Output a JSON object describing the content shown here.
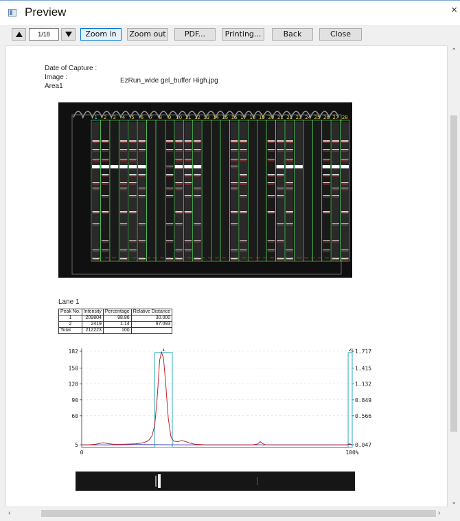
{
  "window": {
    "title": "Preview",
    "close_glyph": "×"
  },
  "toolbar": {
    "page_indicator": "1/18",
    "zoom_in_label": "Zoom in",
    "zoom_out_label": "Zoom out",
    "pdf_label": "PDF...",
    "printing_label": "Printing...",
    "back_label": "Back",
    "close_label": "Close",
    "icons": [
      "page-up-icon",
      "page-down-icon"
    ]
  },
  "report": {
    "date_label": "Date of Capture :",
    "image_label": "Image :",
    "image_value": "EzRun_wide gel_buffer High.jpg",
    "area_label": "Area1"
  },
  "gel": {
    "lane_labels": [
      "1",
      "2",
      "3",
      "4",
      "5",
      "6",
      "7",
      "8",
      "9",
      "10",
      "11",
      "12",
      "13",
      "14",
      "15",
      "16",
      "17",
      "18",
      "19",
      "20",
      "21",
      "22",
      "23",
      "24",
      "25",
      "26",
      "27",
      "28"
    ]
  },
  "lane_table": {
    "title": "Lane 1",
    "headers": [
      "Peak No.",
      "Intensity",
      "Percentage",
      "Relative Distance"
    ],
    "rows": [
      [
        "1",
        "209804",
        "98.86",
        "30.000"
      ],
      [
        "2",
        "2419",
        "1.14",
        "97.093"
      ],
      [
        "Total",
        "212223",
        "100",
        ""
      ]
    ]
  },
  "chart_data": {
    "type": "line",
    "title": "",
    "xlabel": "",
    "ylabel": "",
    "x_tick_labels": [
      "0",
      "100%"
    ],
    "y_left_ticks": [
      "182",
      "150",
      "120",
      "90",
      "60",
      "5"
    ],
    "y_right_ticks": [
      "1.717",
      "1.415",
      "1.132",
      "0.849",
      "0.566",
      "0.047"
    ],
    "xlim": [
      0,
      100
    ],
    "ylim": [
      0,
      182
    ],
    "peak_labels": [
      "1",
      "2"
    ],
    "peak_markers": [
      {
        "label": "1",
        "x_start": 27,
        "x_end": 33.5
      },
      {
        "label": "2",
        "x_start": 98.5,
        "x_end": 100
      }
    ],
    "series": [
      {
        "color": "#c0202a",
        "x": [
          0,
          2,
          5,
          8,
          10,
          12,
          15,
          18,
          20,
          22,
          24,
          25,
          26,
          27,
          28,
          28.8,
          29.5,
          30.2,
          31,
          32,
          33,
          34,
          35.5,
          37,
          38.5,
          40,
          42,
          44,
          46,
          50,
          55,
          60,
          63,
          65,
          66,
          67,
          68,
          70,
          75,
          80,
          85,
          90,
          95,
          98,
          99,
          100
        ],
        "y": [
          5,
          5,
          6,
          9,
          7,
          6,
          6,
          6.5,
          7,
          8,
          11,
          15,
          22,
          42,
          100,
          165,
          180,
          170,
          125,
          55,
          20,
          12,
          11,
          13,
          11,
          8,
          6,
          5.5,
          5,
          5,
          5,
          5,
          5,
          6.5,
          11,
          7,
          5,
          5,
          5,
          5,
          5,
          5,
          5,
          5,
          7,
          5
        ]
      },
      {
        "color": "#3a3ab0",
        "x": [
          0,
          10,
          20,
          40,
          60,
          80,
          98,
          99,
          100
        ],
        "y": [
          5,
          5,
          5.5,
          5,
          5,
          5,
          5,
          6,
          5
        ]
      }
    ],
    "grid": true,
    "legend": "none"
  },
  "colors": {
    "gel_background": "#101010",
    "lane_grid": "#58d060",
    "lane_label": "#d8d040",
    "band_marker": "#e03030",
    "peak_box": "#52b8c8",
    "profile_line": "#c0202a"
  }
}
